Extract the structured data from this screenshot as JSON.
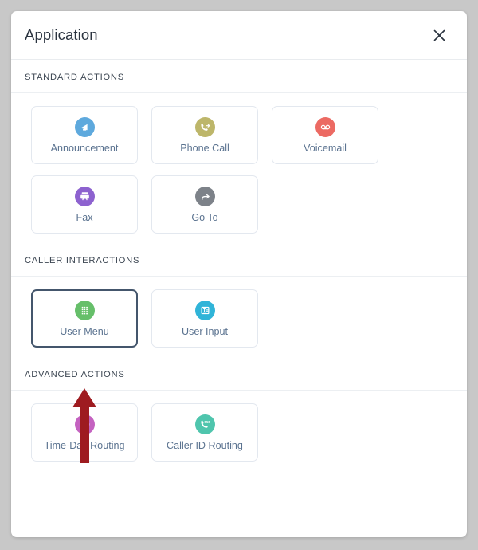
{
  "dialog": {
    "title": "Application",
    "close_icon": "close-icon"
  },
  "sections": [
    {
      "id": "standard-actions",
      "header": "STANDARD ACTIONS",
      "rows": [
        [
          {
            "label": "Announcement",
            "icon": "megaphone-icon",
            "color": "#5ea9dd",
            "selected": false
          },
          {
            "label": "Phone Call",
            "icon": "phone-forward-icon",
            "color": "#bdb66a",
            "selected": false
          },
          {
            "label": "Voicemail",
            "icon": "voicemail-icon",
            "color": "#ec6a63",
            "selected": false
          }
        ],
        [
          {
            "label": "Fax",
            "icon": "fax-icon",
            "color": "#8d62cf",
            "selected": false
          },
          {
            "label": "Go To",
            "icon": "goto-arrow-icon",
            "color": "#7d8289",
            "selected": false
          }
        ]
      ]
    },
    {
      "id": "caller-interactions",
      "header": "CALLER INTERACTIONS",
      "rows": [
        [
          {
            "label": "User Menu",
            "icon": "keypad-icon",
            "color": "#66bf6a",
            "selected": true
          },
          {
            "label": "User Input",
            "icon": "form-input-icon",
            "color": "#30b4d8",
            "selected": false
          }
        ]
      ]
    },
    {
      "id": "advanced-actions",
      "header": "ADVANCED ACTIONS",
      "rows": [
        [
          {
            "label": "Time-Day Routing",
            "icon": "clock-icon",
            "color": "#c462c0",
            "selected": false
          },
          {
            "label": "Caller ID Routing",
            "icon": "caller-id-phone-icon",
            "color": "#4fc5ad",
            "selected": false
          }
        ]
      ]
    }
  ],
  "annotation": {
    "arrow": "up-arrow-annotation",
    "color": "#9e1b20"
  }
}
